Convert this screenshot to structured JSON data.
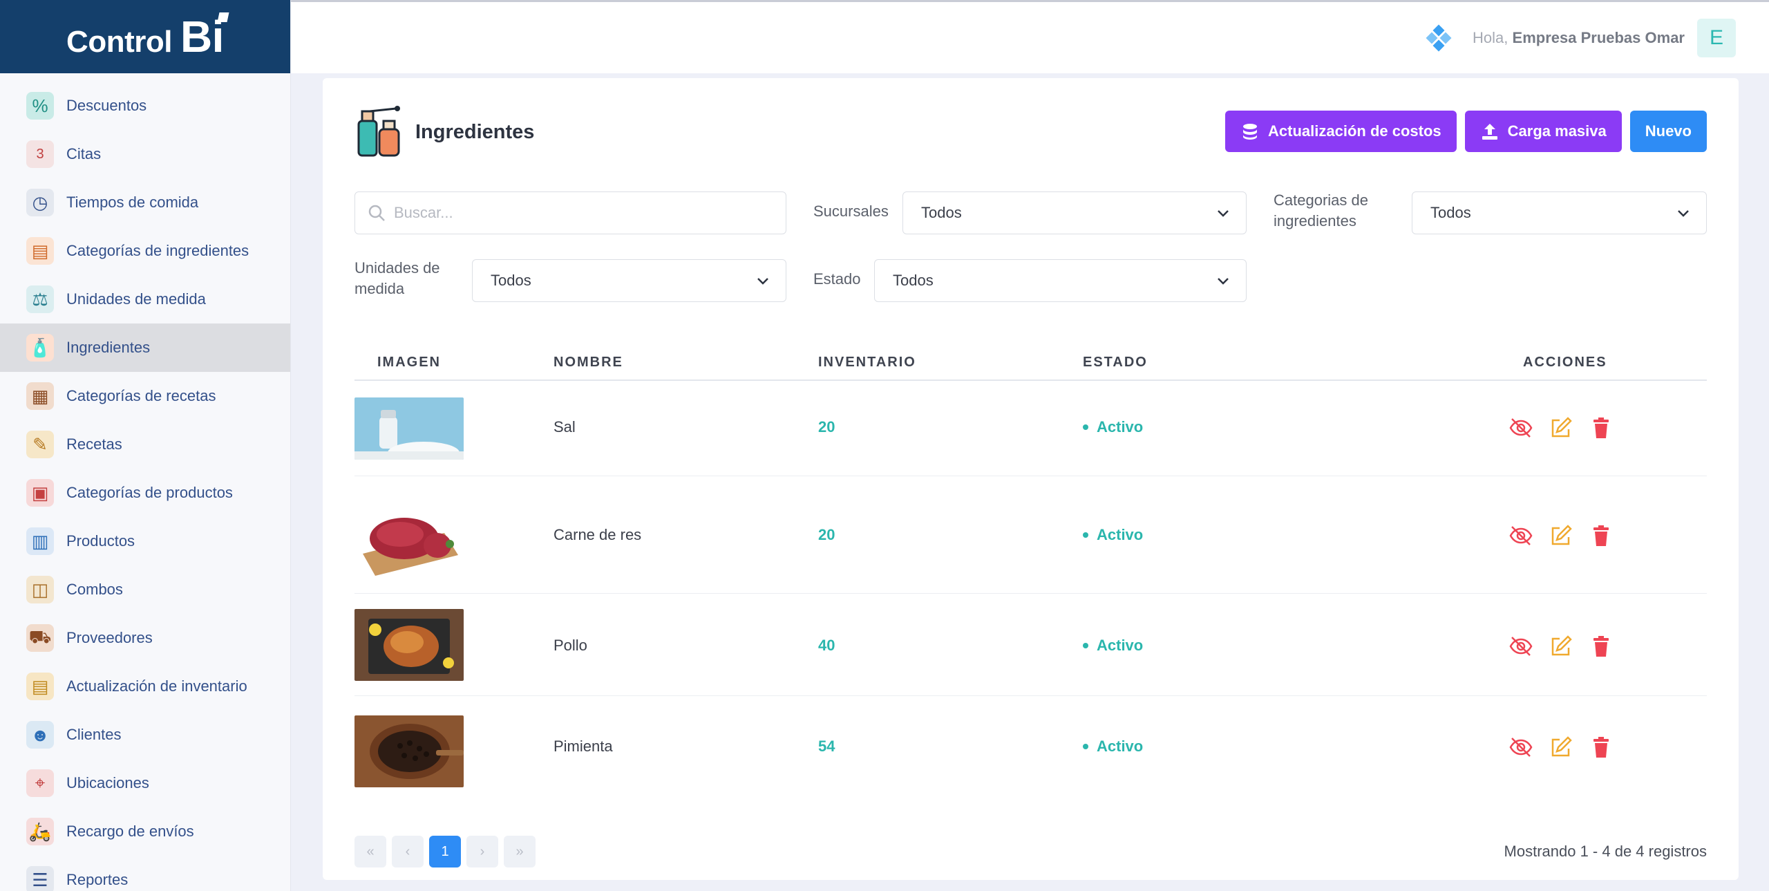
{
  "brand": {
    "name": "Control",
    "suffix": "Bi"
  },
  "sidebar": {
    "items": [
      {
        "label": "Descuentos",
        "icon": "discount-icon",
        "active": false
      },
      {
        "label": "Citas",
        "icon": "calendar-icon",
        "active": false
      },
      {
        "label": "Tiempos de comida",
        "icon": "meal-time-icon",
        "active": false
      },
      {
        "label": "Categorías de ingredientes",
        "icon": "ingredient-categories-icon",
        "active": false
      },
      {
        "label": "Unidades de medida",
        "icon": "measure-units-icon",
        "active": false
      },
      {
        "label": "Ingredientes",
        "icon": "ingredients-icon",
        "active": true
      },
      {
        "label": "Categorías de recetas",
        "icon": "recipe-categories-icon",
        "active": false
      },
      {
        "label": "Recetas",
        "icon": "recipes-icon",
        "active": false
      },
      {
        "label": "Categorías de productos",
        "icon": "product-categories-icon",
        "active": false
      },
      {
        "label": "Productos",
        "icon": "products-icon",
        "active": false
      },
      {
        "label": "Combos",
        "icon": "combos-icon",
        "active": false
      },
      {
        "label": "Proveedores",
        "icon": "suppliers-icon",
        "active": false
      },
      {
        "label": "Actualización de inventario",
        "icon": "inventory-update-icon",
        "active": false
      },
      {
        "label": "Clientes",
        "icon": "clients-icon",
        "active": false
      },
      {
        "label": "Ubicaciones",
        "icon": "locations-icon",
        "active": false
      },
      {
        "label": "Recargo de envíos",
        "icon": "delivery-icon",
        "active": false
      },
      {
        "label": "Reportes",
        "icon": "reports-icon",
        "active": false
      }
    ]
  },
  "topbar": {
    "greeting": "Hola,",
    "user": "Empresa Pruebas Omar",
    "avatar_letter": "E"
  },
  "page": {
    "title": "Ingredientes"
  },
  "buttons": {
    "update_costs": "Actualización de costos",
    "bulk_upload": "Carga masiva",
    "new": "Nuevo"
  },
  "filters": {
    "search_placeholder": "Buscar...",
    "branches_label": "Sucursales",
    "branches_value": "Todos",
    "categories_label_1": "Categorias de",
    "categories_label_2": "ingredientes",
    "categories_value": "Todos",
    "units_label_1": "Unidades de",
    "units_label_2": "medida",
    "units_value": "Todos",
    "status_label": "Estado",
    "status_value": "Todos"
  },
  "table": {
    "headers": {
      "image": "IMAGEN",
      "name": "NOMBRE",
      "inventory": "INVENTARIO",
      "status": "ESTADO",
      "actions": "ACCIONES"
    },
    "rows": [
      {
        "name": "Sal",
        "inventory": "20",
        "status": "Activo"
      },
      {
        "name": "Carne de res",
        "inventory": "20",
        "status": "Activo"
      },
      {
        "name": "Pollo",
        "inventory": "40",
        "status": "Activo"
      },
      {
        "name": "Pimienta",
        "inventory": "54",
        "status": "Activo"
      }
    ]
  },
  "pagination": {
    "current": "1",
    "first": "«",
    "prev": "‹",
    "next": "›",
    "last": "»",
    "summary": "Mostrando 1 - 4 de 4 registros"
  },
  "colors": {
    "brand": "#143f6b",
    "purple": "#8b3bf5",
    "blue": "#2e8cf5",
    "teal": "#2bb6ad",
    "warning": "#f0a92e",
    "danger": "#ee4453"
  }
}
